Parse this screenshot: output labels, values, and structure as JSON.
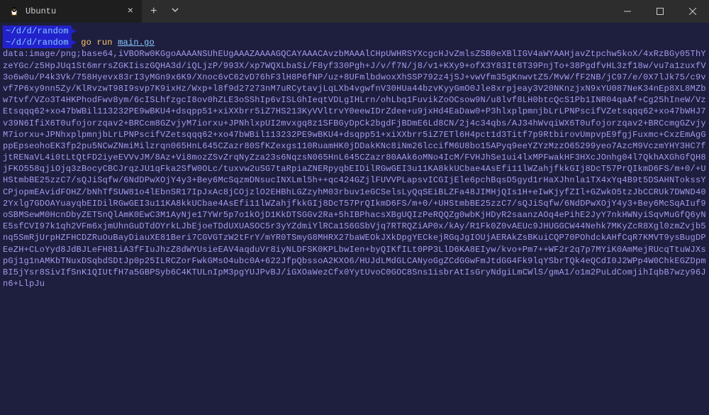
{
  "titlebar": {
    "tab": {
      "title": "Ubuntu",
      "icon": "penguin"
    }
  },
  "terminal": {
    "prompt_path": "~/d/d/random",
    "command_bin": "go",
    "command_sub": "run",
    "command_arg": "main.go",
    "output": "data:image/png;base64,iVBORw0KGgoAAAANSUhEUgAAAZAAAAGQCAYAAACAvzbMAAAlCHpUWHRSYXcgcHJvZmlsZSB0eXBlIGV4aWYAAHjavZtpchw5koX/4xRzBGy05ThYzeYGc/z5HpJUq1St6mrrsZGKIiszGQHA3d/iQLjzP/993X/xp7WQXLbaSi/F8yf330Pgh+J/v/f7N/j8/v1+KXy9+ofX3Y83It8T39PnjTo+38PgdfvHL3zf18w/vu7a1zuxfV3o6w0u/P4k3Vk/758Hyevx83rI3yMGn9x6K9/Xnoc6vC62vD76hF3lH8P6fNP/uz+8UFmlbdwoxXhSSP792z4jSJ+vwVfm35gKnwvtZ5/MvW/fF2NB/jC97/e/0X7lJk75/c9vvf7P6xy9nn5Zy/KlRvzwT98I9svp7K9ixHz/Wxp+l8f9d27273nM7uRCytavjLqLXb4vgwfnV30HUa44bzvKyyGmO0Jle8xrpjeay3V20NKnzjxN9xYU087NeK34nEp8XL8MZbw7tvf/VZo3T4HKPhodFwv8ym/6cISLhfzgcI8ov0hZLE3oSShIp6vISLGhIeqtVDLgIHLrn/ohLbq1FuvikZoOCsow9N/u8lvf8LH0btcQcS1Pb1INR04qaAf+Cg25hIneW/VzEtsqqq62+xo47bWBil113232PE9wBKU4+dsqpp51+xiXXbrr5iZ7HS213KyVVltrvY0eewIDrZdee+u9jxHd4EaDaw0+P3hlxplpmnjbLrLPNPscifVZetsqqq62+xo47bWHJ7v39N6IfiX6T0ufojorzqav2+BRCcm8GZvjyM7iorxu+JPNhlxpUI2mvxgq8z1SFBGyDpCk2bgdFjBDmE6Ld8CN/2j4c34qbs/AJ34hWvqiWX6T0ufojorzqav2+BRCcmgGZvjyM7iorxu+JPNhxplpmnjbLrLPNPscifVZetsqqq62+xo47bWBil113232PE9wBKU4+dsqpp51+xiXXbrr5iZ7ETl6H4pct1d3Titf7p9RtbirovUmpvpE9fgjFuxmc+CxzEmAgGppEpseohoEK3fp2pu5NCwZNmiMilzrqn065HnL645CZazr80SfKZexgs110RuamHK0jDDakKNc8iNm26lccifM6U8bo15APyq9eeYZYzMzzO65299yeo7AzcM9VczmYHY3HC7fjtRENaVL4i0tLtQtFD2iyeEVVvJM/8Az+Vi8mozZSvZrqNyZza23s6NqzsN065HnL645CZazr80AAk6oMNo4IcM/FVHJhSe1ui4lxMPFwakHF3HXcJOnhg04l7QkhAXGhGfQH8jFKO558qjiOjq3zBocyCBCJrqzJU1qFka2SfW0OLc/tuxvw2uSG7taRpiaZNERpyqbEIDilRGwGEI3u11KA8kkUCbae4AsEfi11lWZahjfkkGIj8DcT57PrQIkmD6FS/m+0/+UHStmbBE25zzC7/sQJiSqfw/6NdDPwXOjY4y3+Bey6McSqzmDNsucINXLml5h++qc424GZjlFUVVPLapsvICGIjEle6pchBqsD5gyd1rHaXJhnla1TX4xYq4B9t5DSAHNTokssYCPjopmEAvidFOHZ/bNhTfSUW81o4lEbnSR17IpJxAc8jCOjzlO2EHBhLGZzyhM03rbuv1eGCSelsLyQqSEiBLZFa48JIMHjQIs1H+eIwKjyfZIl+GZwkO5tzJbCCRUk7DWND402Yxlg7GDOAYuayqbEIDilRGwGEI3u11KA8kkUCbae4AsEfi11lWZahjfkkGIj8DcT57PrQIkmD6FS/m+0/+UHStmbBE25zzC7/sQJiSqfw/6NdDPwXOjY4y3+Bey6McSqAIuf9oSBMSewM0HcnDbyZET5nQlAmK0EwC3M1AyNje17YWr5p7o1kOjD1KkDTSGGv2Ra+5hIBPhacsXBgUQIzPeRQQZg0wbKjHDyR2saanzAOq4ePihE2JyY7nkHWNyiSqvMuGfQ6yNE5sfCVI97k1qh2VFm6xjmUhnGuDTdOYrkLJbEjoeTDdUXUASOC5r3yYZdmiYlRCa1S6GSbVjq7RTRQZiAP0x/kAy/R1Fk0Z0vAEUc9JHUGGCW44Nehk7MKyZcR8Xgl0zmZvjb5nq5SmRjUrpHZFHCDZRuOuBayDiauXE81Beri7CGVGTzW2tFrY/mYR0TSmyG8MHRX27baWEOkJXkDpgYECkejRGqJgIOUjAERAkZsBKuiCQP70POhdckAHfCqR7KMVT9ysBugDPEeZH+CLoYyd8JdBJLeFH81iA3fFIuJhzZ8dWYUsieEAV4aqduVr8iyNLDFSK0KPLbwIen+byQIKfILt0PP3LlD6KA8EIyw/kvo+Pm7++WF2r2q7p7MYiK0AmMejRUcqTtuWJXspGj1g1nAMKbTNuxDSqbdSDtJp0p25ILRCZorFwkGMsO4ubc0A+622JfpQbssoA2KXO6/HUJdLMdGLCANyoGgZCdGGwFmJtdGG4Fk9lqYSbrTQk4eQCdI0J2WPp4W0ChkEGZDpmBI5jYsr8SivIfSnK1QIUtfH7a5GBPSyb6C4KTULnIpM3pgYUJPvBJ/iGXOaWezCfx0YytUvoC0GOC8Sns1isbrAtIsGryNdgiLmCWlS/gmA1/o1m2PuLdComjihIqbB7wzy96Jn6+LlpJu"
  }
}
